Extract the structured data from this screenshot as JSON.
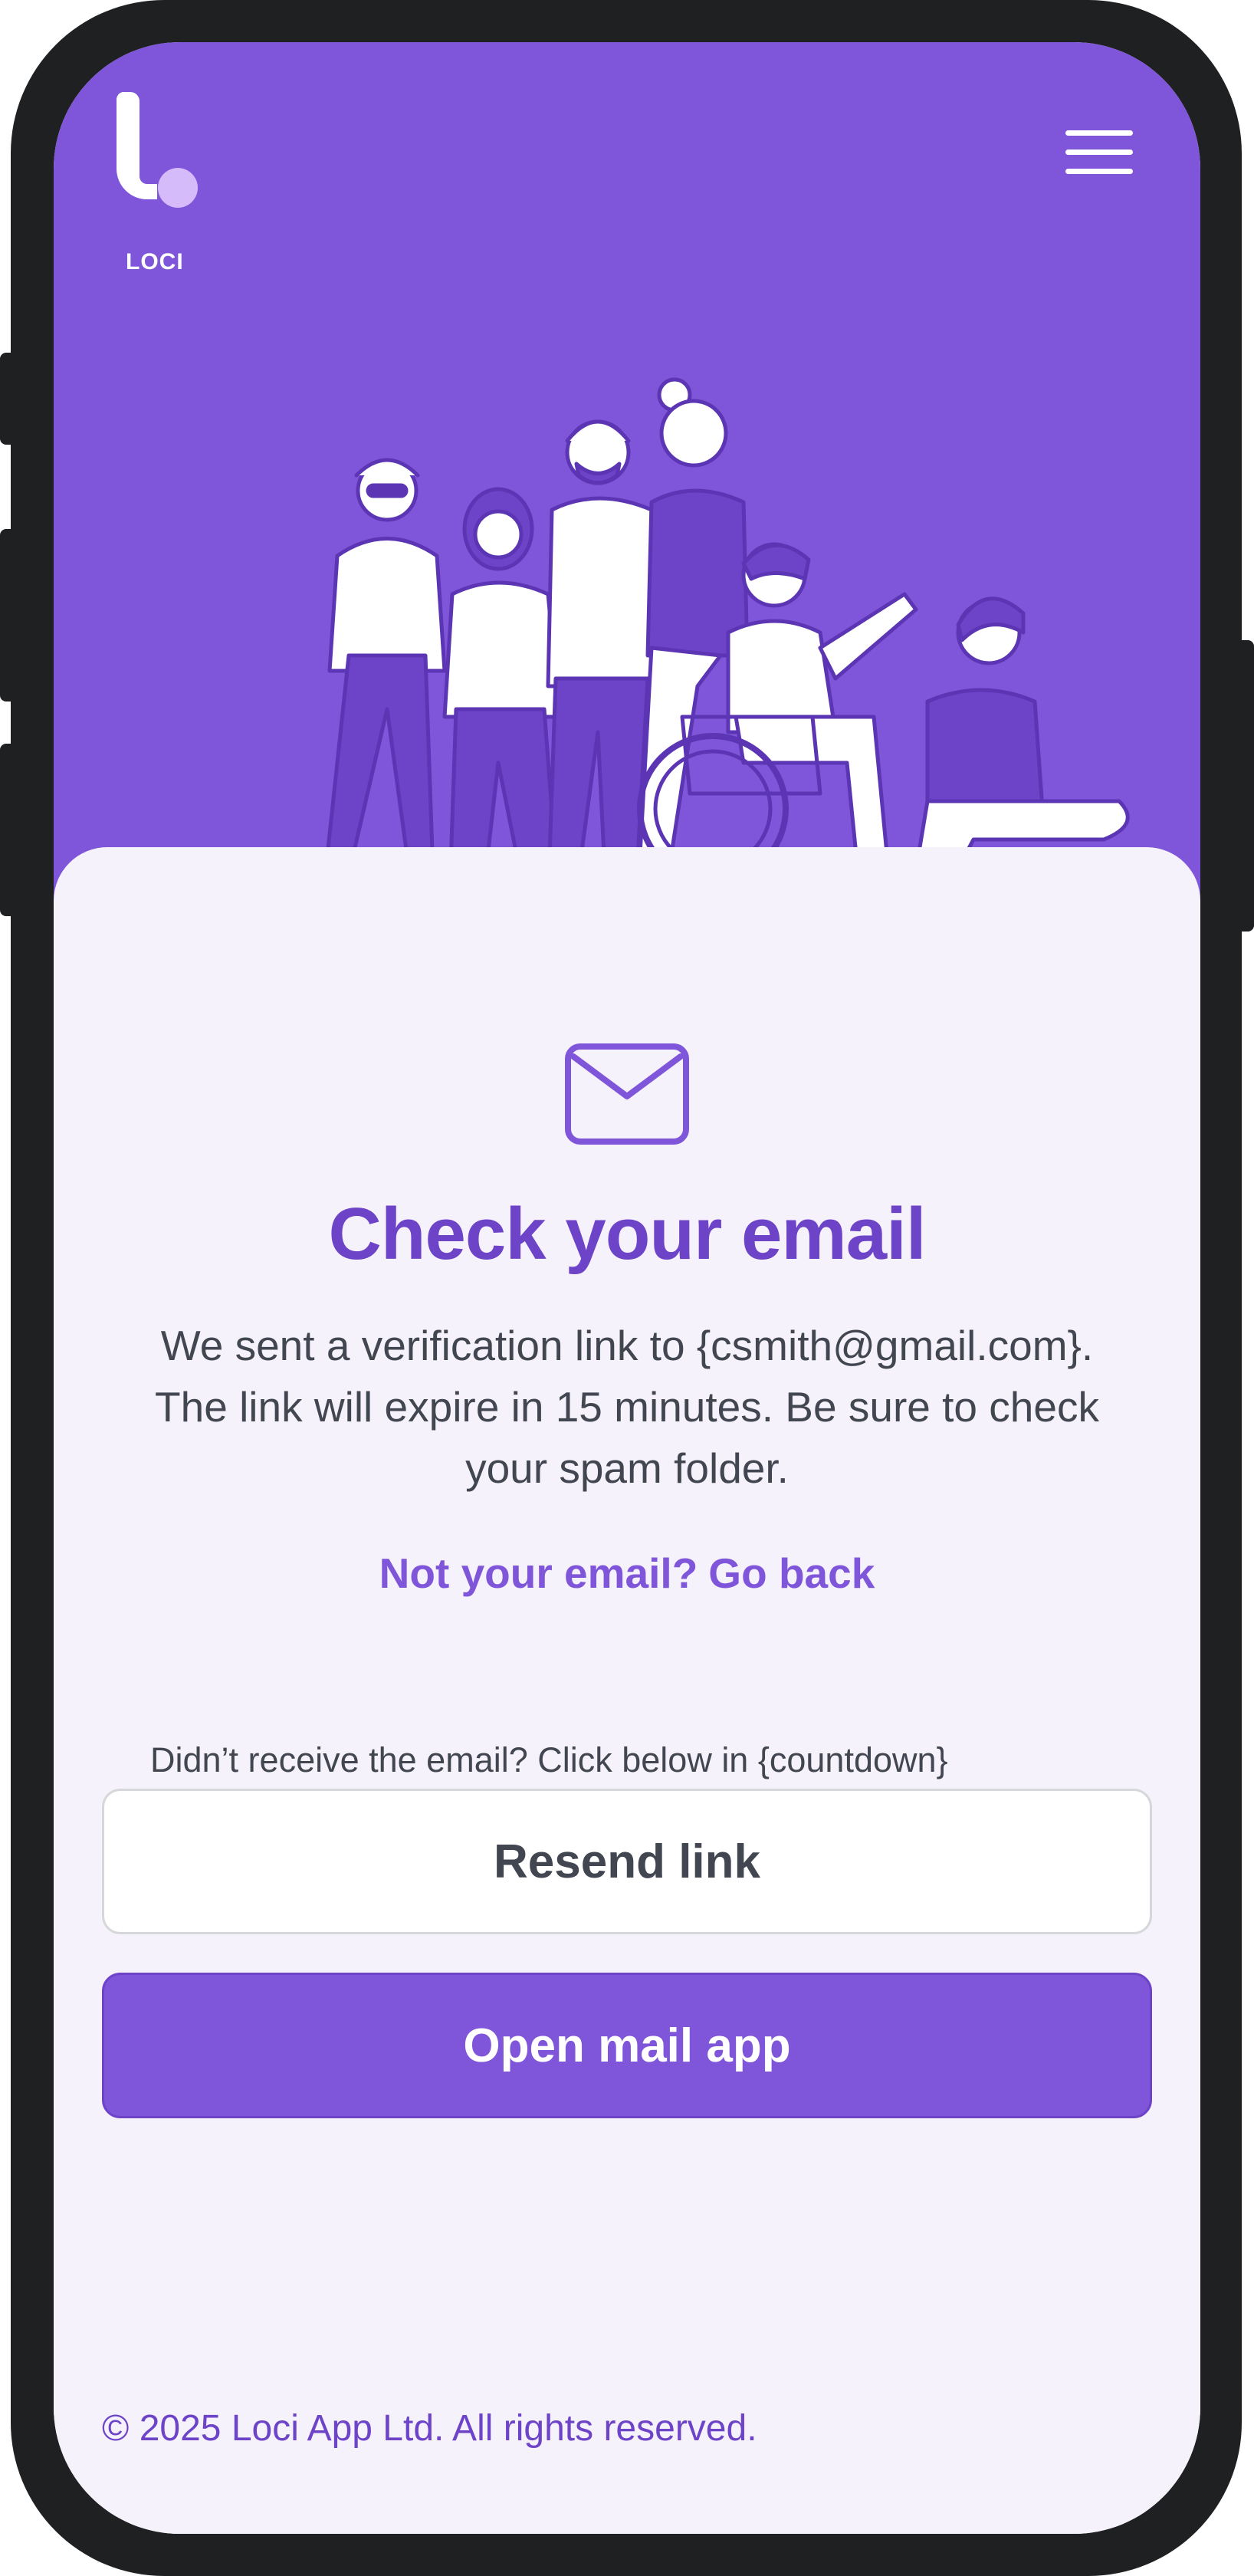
{
  "app": {
    "logo_text": "LOCI",
    "accent_color": "#7F56D9",
    "title_color": "#6D43C8"
  },
  "header": {
    "menu_icon": "hamburger-menu-icon"
  },
  "hero": {
    "illustration": "group-of-diverse-people-illustration"
  },
  "content": {
    "icon": "mail-icon",
    "title": "Check your email",
    "description": "We sent a verification link to {csmith@gmail.com}. The link will expire in 15 minutes. Be sure to check your spam folder.",
    "not_your_email": "Not your email?",
    "go_back": "Go back",
    "resend_hint": "Didn’t receive the email? Click below in {countdown}",
    "resend_button": "Resend link",
    "open_mail_button": "Open mail app"
  },
  "footer": {
    "copyright": "© 2025 Loci App Ltd. All rights reserved."
  }
}
